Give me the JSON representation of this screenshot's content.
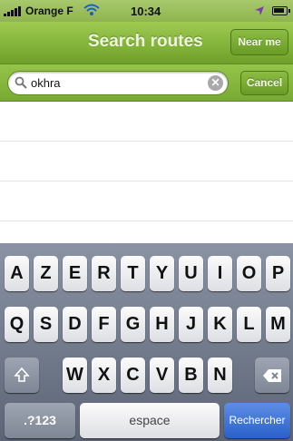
{
  "status_bar": {
    "carrier": "Orange F",
    "time": "10:34"
  },
  "nav_bar": {
    "title": "Search routes",
    "near_me_label": "Near me"
  },
  "search": {
    "value": "okhra",
    "cancel_label": "Cancel"
  },
  "results": {
    "row_count": 3
  },
  "keyboard": {
    "row1": [
      "A",
      "Z",
      "E",
      "R",
      "T",
      "Y",
      "U",
      "I",
      "O",
      "P"
    ],
    "row2": [
      "Q",
      "S",
      "D",
      "F",
      "G",
      "H",
      "J",
      "K",
      "L",
      "M"
    ],
    "row3": [
      "W",
      "X",
      "C",
      "V",
      "B",
      "N"
    ],
    "mode_label": ".?123",
    "space_label": "espace",
    "return_label": "Rechercher"
  },
  "colors": {
    "bar_green": "#84b43a",
    "keyboard_return_blue": "#2a61c9"
  }
}
